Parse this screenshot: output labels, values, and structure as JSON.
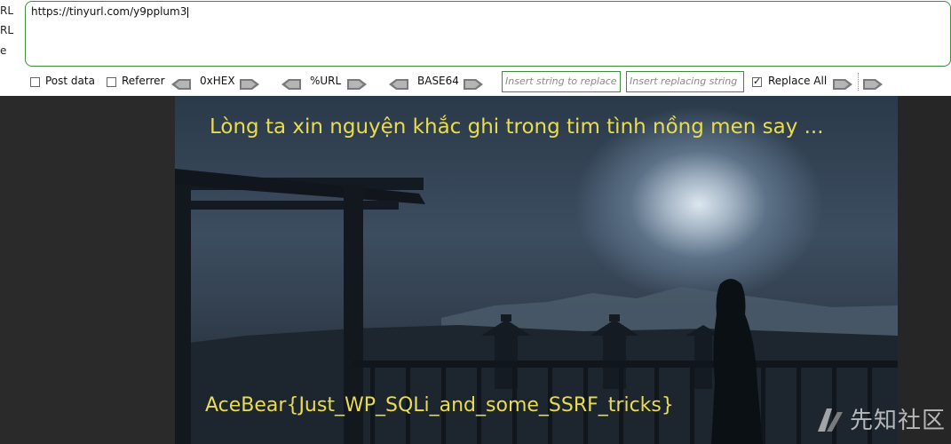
{
  "left_labels": [
    "RL",
    "RL",
    "e"
  ],
  "url_value": "https://tinyurl.com/y9pplum3",
  "controls": {
    "post_data_label": "Post data",
    "referrer_label": "Referrer",
    "hex_label": "0xHEX",
    "url_label": "%URL",
    "base64_label": "BASE64",
    "insert_find_placeholder": "Insert string to replace",
    "insert_replace_placeholder": "Insert replacing string",
    "replace_all_label": "Replace All"
  },
  "image_text": {
    "verse": "Lòng ta xin nguyện khắc ghi trong tim tình nồng men say ...",
    "flag": "AceBear{Just_WP_SQLi_and_some_SSRF_tricks}"
  },
  "watermark": {
    "text": "先知社区",
    "logo_icon": "xianzhi-logo-icon"
  },
  "colors": {
    "accent_border": "#3c8c3c",
    "overlay_text": "#e9dc4e"
  }
}
